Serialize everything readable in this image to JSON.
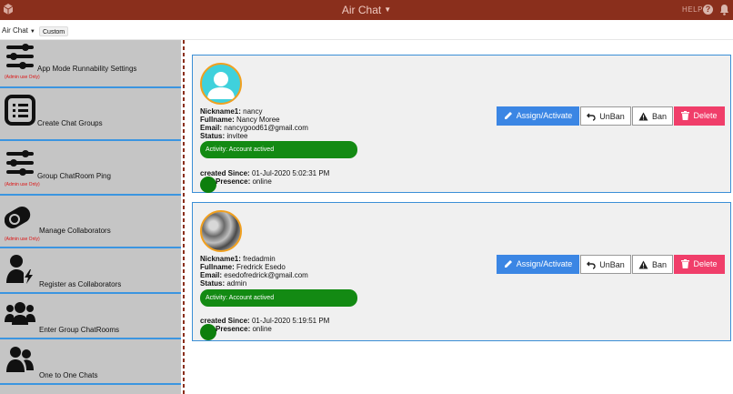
{
  "topbar": {
    "title": "Air Chat",
    "help": "HELP",
    "help_glyph": "?"
  },
  "subbar": {
    "select_value": "Air Chat",
    "custom_label": "Custom"
  },
  "sidebar": {
    "items": [
      {
        "label": "App Mode Runnability Settings",
        "note": "(Admin use Only)",
        "icon": "sliders-icon"
      },
      {
        "label": "Create Chat Groups",
        "note": "",
        "icon": "list-icon"
      },
      {
        "label": "Group ChatRoom Ping",
        "note": "(Admin use Only)",
        "icon": "sliders-icon"
      },
      {
        "label": "Manage Collaborators",
        "note": "(Admin use Only)",
        "icon": "toggle-icon"
      },
      {
        "label": "Register as Collaborators",
        "note": "",
        "icon": "user-bolt-icon"
      },
      {
        "label": "Enter Group ChatRooms",
        "note": "",
        "icon": "users-group-icon"
      },
      {
        "label": "One to One Chats",
        "note": "",
        "icon": "user-pair-icon"
      }
    ]
  },
  "labels": {
    "nickname": "Nickname1:",
    "fullname": "Fullname:",
    "email": "Email:",
    "status": "Status:",
    "created": "created Since:",
    "presence": "Presence:"
  },
  "buttons": {
    "assign": "Assign/Activate",
    "unban": "UnBan",
    "ban": "Ban",
    "delete": "Delete"
  },
  "users": [
    {
      "nickname": "nancy",
      "fullname": "Nancy Moree",
      "email": "nancygood61@gmail.com",
      "status": "invitee",
      "activity": "Activity: Account actived",
      "created": "01-Jul-2020 5:02:31 PM",
      "presence": "online"
    },
    {
      "nickname": "fredadmin",
      "fullname": "Fredrick Esedo",
      "email": "esedofredrick@gmail.com",
      "status": "admin",
      "activity": "Activity: Account actived",
      "created": "01-Jul-2020 5:19:51 PM",
      "presence": "online"
    }
  ],
  "colors": {
    "topbar": "#8a2f1c",
    "sidebar": "#c5c5c5",
    "accent": "#3b86e4",
    "delete": "#f03e6a",
    "activity": "#138a13",
    "avatar_ring": "#f0a020"
  }
}
